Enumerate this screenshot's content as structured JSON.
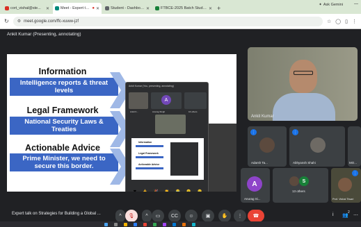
{
  "browser": {
    "tabs": [
      {
        "label": "cort_vishal@ste...",
        "favicon_color": "#d93025",
        "active": false
      },
      {
        "label": "Meet - Expert talk on Stra",
        "favicon_color": "#00897b",
        "active": true
      },
      {
        "label": "Student - Dashboard",
        "favicon_color": "#5f6368",
        "active": false
      },
      {
        "label": "FTBCE-2025 Batch Students Info",
        "favicon_color": "#188038",
        "active": false
      }
    ],
    "new_tab": "+",
    "ask_gemini": "Ask Gemini",
    "url": "meet.google.com/ffc-xuww-jzf"
  },
  "meet": {
    "presenting_label": "Ankit Kumar (Presenting, annotating)",
    "slide": {
      "items": [
        {
          "heading": "Information",
          "box": "Intelligence reports & threat levels"
        },
        {
          "heading": "Legal Framework",
          "box": "National Security Laws & Treaties"
        },
        {
          "heading": "Actionable Advice",
          "box": "Prime Minister, we need to secure this border."
        }
      ]
    },
    "popup": {
      "top_label": "Ankit Kumar (You, presenting, annotating)",
      "tiles": [
        {
          "name": "Ankit K..."
        },
        {
          "name": "Anurag Singh",
          "initial": "A"
        },
        {
          "name": "16 others"
        }
      ],
      "slide_headings": [
        "Information",
        "Legal Framework",
        "Actionable Advice"
      ]
    },
    "main_camera": {
      "name": "Ankit Kumar"
    },
    "participants": [
      {
        "name": "Adarsh Ta...",
        "kind": "photo"
      },
      {
        "name": "Abhyansh Shahi",
        "kind": "photo"
      },
      {
        "name": "MO...",
        "kind": "photo"
      },
      {
        "name": "Anurag Si...",
        "kind": "initial",
        "initial": "A",
        "color": "#8e44c9"
      },
      {
        "name": "13 others",
        "kind": "group",
        "initial": "S",
        "color": "#188038"
      },
      {
        "name": "Prof. Vishal Tiwari",
        "kind": "photo"
      }
    ],
    "meeting_title": "Expert talk on Strategies for Building a Global ...",
    "mute_icon": "mic-off-icon",
    "accent_end_color": "#ea4335",
    "right_controls": [
      "i",
      "2",
      "⋯"
    ],
    "participant_count": "2"
  }
}
